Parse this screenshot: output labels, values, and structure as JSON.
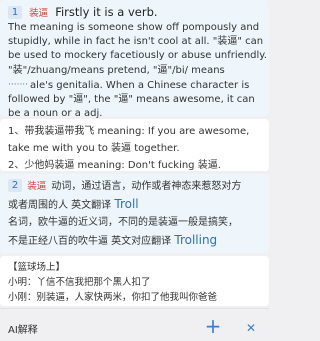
{
  "card1": {
    "badge": "1",
    "tag": "装逼",
    "head": "Firstly it is a verb.",
    "lines": [
      "The meaning is someone show off pompously and",
      "stupidly, while in fact he isn't cool at all. \"装逼\" can",
      "be used to mockery facetiously or abuse unfriendly.",
      "\"装\"/zhuang/means pretend, \"逼\"/bi/ means",
      "ale's genitalia. When a Chinese character is",
      "followed by \"逼\", the \"逼\" means awesome, it can",
      "be a noun or a adj."
    ]
  },
  "card2": {
    "lines": [
      "1、带我装逼带我飞 meaning: If you are awesome,",
      "take me with you to 装逼 together.",
      "2、少他妈装逼 meaning: Don't fucking 装逼."
    ]
  },
  "card3": {
    "badge": "2",
    "tag": "装逼",
    "head_rest": "动词，通过语言，动作或者神态来惹怒对方",
    "line2_prefix": "或者周围的人 英文翻译",
    "line2_word": "Troll",
    "line3": "名词，欧牛逼的近义词，不同的是装逼一般是搞笑，",
    "line4_prefix": "不是正经八百的吹牛逼 英文对应翻译",
    "line4_word": "Trolling"
  },
  "card4": {
    "lines": [
      "【篮球场上】",
      "小明：丫信不信我把那个黑人扣了",
      "小刚：别装逼，人家快两米，你扣了他我叫你爸爸"
    ]
  },
  "bottom": {
    "ai_label": "AI解释",
    "plus_symbol": "+",
    "close_symbol": "✕"
  }
}
